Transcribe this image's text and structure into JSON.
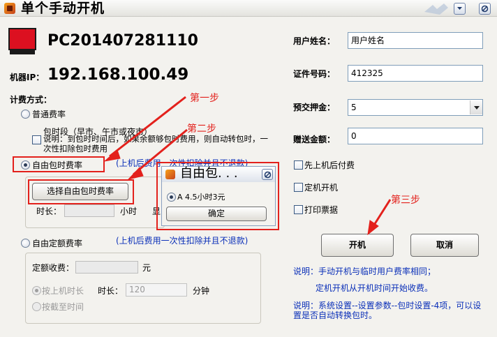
{
  "window": {
    "title": "单个手动开机"
  },
  "machine": {
    "name": "PC201407281110",
    "ip_label": "机器IP：",
    "ip": "192.168.100.49"
  },
  "billing": {
    "label": "计费方式：",
    "normal_rate": "普通费率",
    "time_package_label": "包时段（早市、午市或夜市）",
    "time_package_note_1": "说明：到包时时间后，如果余额够包时费用，则自动转包时，一",
    "time_package_note_2": "次性扣除包时费用",
    "free_package": "自由包时费率",
    "free_package_note": "(上机后费用一次性扣除并且不退款)",
    "select_button": "选择自由包时费率",
    "duration_label": "时长：",
    "hour_unit": "小时",
    "cut_char": "显",
    "fixed_rate": "自由定额费率",
    "fixed_rate_note": "(上机后费用一次性扣除并且不退款)",
    "fixed_fee_label": "定额收费：",
    "yuan_unit": "元",
    "by_duration": "按上机时长",
    "fixed_duration_label": "时长：",
    "fixed_duration_value": "120",
    "minute_unit": "分钟",
    "by_deadline": "按截至时间"
  },
  "form": {
    "username_label": "用户姓名：",
    "username_value": "用户姓名",
    "id_label": "证件号码：",
    "id_value": "412325",
    "deposit_label": "预交押金：",
    "deposit_value": "5",
    "gift_label": "赠送金额：",
    "gift_value": "0",
    "post_pay": "先上机后付费",
    "scheduled_boot": "定机开机",
    "print_receipt": "打印票据"
  },
  "actions": {
    "boot": "开机",
    "cancel": "取消"
  },
  "notes": {
    "note1": "说明：手动开机与临时用户费率相同；",
    "note2": "定机开机从开机时间开始收费。",
    "note3_1": "说明：系统设置--设置参数--包时设置-4项，可以设",
    "note3_2": "置是否自动转换包时。"
  },
  "popup": {
    "title": "自由包. . .",
    "option": "A 4.5小时3元",
    "confirm": "确定"
  },
  "annotations": {
    "step1": "第一步",
    "step2": "第二步",
    "step3": "第三步"
  },
  "colors": {
    "annotation_red": "#e3211c",
    "note_blue": "#0a2fb8",
    "pc_icon_red": "#dc1020"
  }
}
